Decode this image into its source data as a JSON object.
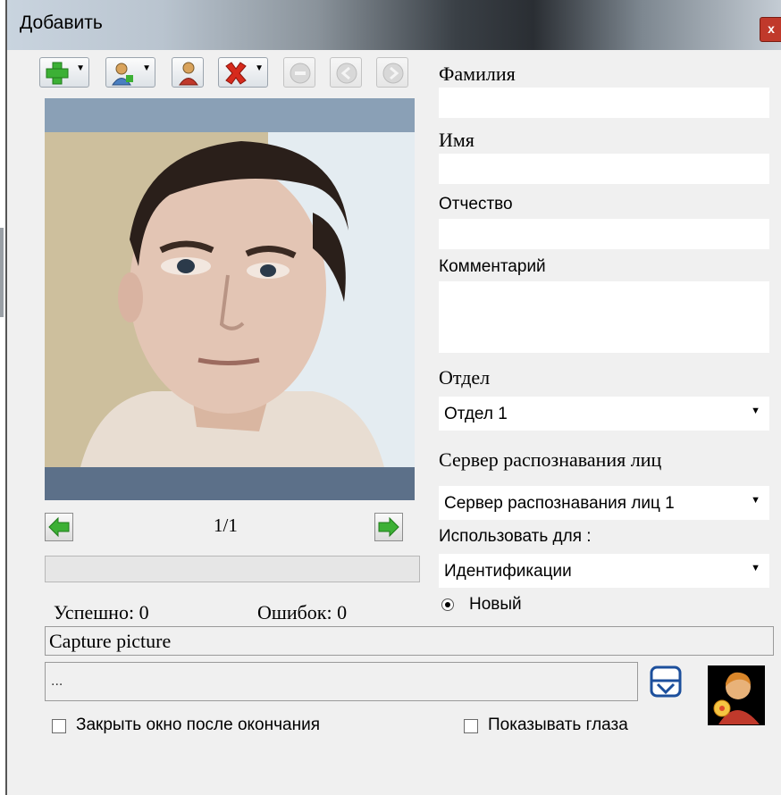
{
  "window": {
    "title": "Добавить",
    "close_glyph": "x"
  },
  "toolbar": {
    "buttons": [
      {
        "icon": "add-icon"
      },
      {
        "icon": "user-dropdown-icon"
      },
      {
        "icon": "user-icon"
      },
      {
        "icon": "delete-icon"
      },
      {
        "icon": "stop-icon"
      },
      {
        "icon": "prev-circle-icon"
      },
      {
        "icon": "next-circle-icon"
      }
    ]
  },
  "viewer": {
    "counter": "1/1",
    "success": "Успешно: 0",
    "errors": "Ошибок: 0"
  },
  "form": {
    "last_name_label": "Фамилия",
    "last_name_value": "",
    "first_name_label": "Имя",
    "first_name_value": "",
    "patronymic_label": "Отчество",
    "patronymic_value": "",
    "comment_label": "Комментарий",
    "comment_value": "",
    "department_label": "Отдел",
    "department_value": "Отдел 1",
    "server_label": "Сервер распознавания лиц",
    "server_value": "Сервер распознавания лиц 1",
    "use_for_label": "Использовать для :",
    "use_for_value": "Идентификации",
    "new_radio_label": "Новый"
  },
  "status": {
    "message": "Capture picture",
    "path_value": "..."
  },
  "options": {
    "close_after_label": "Закрыть окно после окончания",
    "show_eyes_label": "Показывать глаза"
  },
  "colors": {
    "accent_green": "#3cb035",
    "delete_red": "#d62a1c",
    "photo_bar": "#5c7089"
  }
}
